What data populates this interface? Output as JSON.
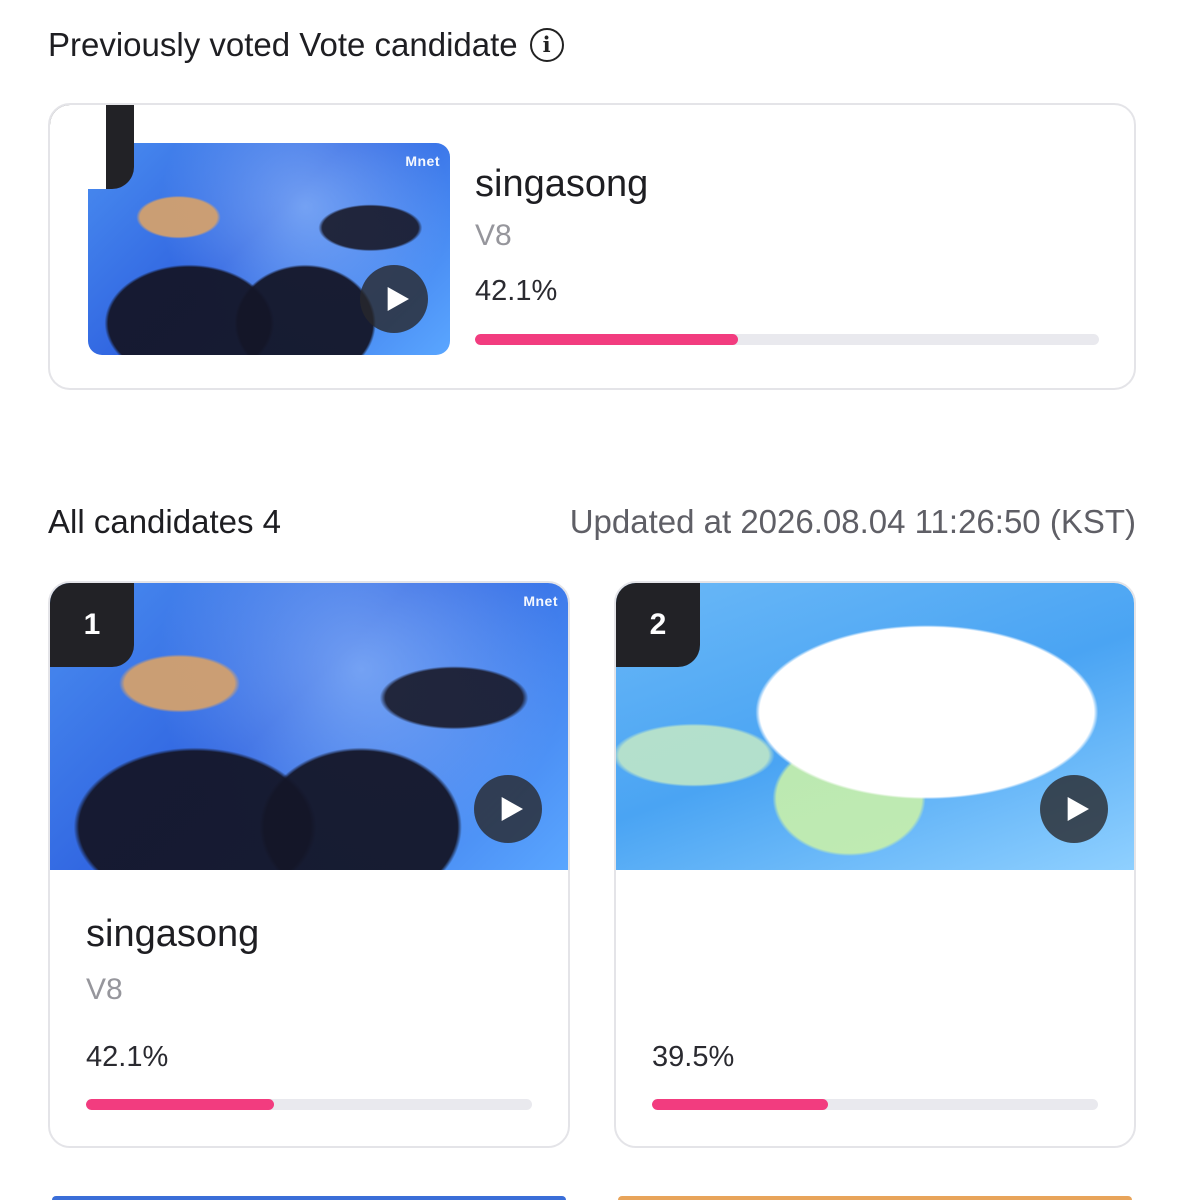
{
  "voted_section": {
    "title": "Previously voted Vote candidate",
    "info_icon": "info-icon",
    "card": {
      "title": "singasong",
      "artist": "V8",
      "percent": "42.1%",
      "progress": 0.421,
      "video_badge": "Mnet"
    }
  },
  "all_section": {
    "title": "All candidates 4",
    "updated": "Updated at 2026.08.04 11:26:50 (KST)"
  },
  "candidates": [
    {
      "rank": "1",
      "title": "singasong",
      "artist": "V8",
      "percent": "42.1%",
      "progress": 0.421,
      "video_badge": "Mnet"
    },
    {
      "rank": "2",
      "title": "",
      "artist": "",
      "percent": "39.5%",
      "progress": 0.395
    }
  ],
  "colors": {
    "accent": "#f23c7f",
    "track": "#e9e9ee",
    "rank_tab": "#222226"
  }
}
